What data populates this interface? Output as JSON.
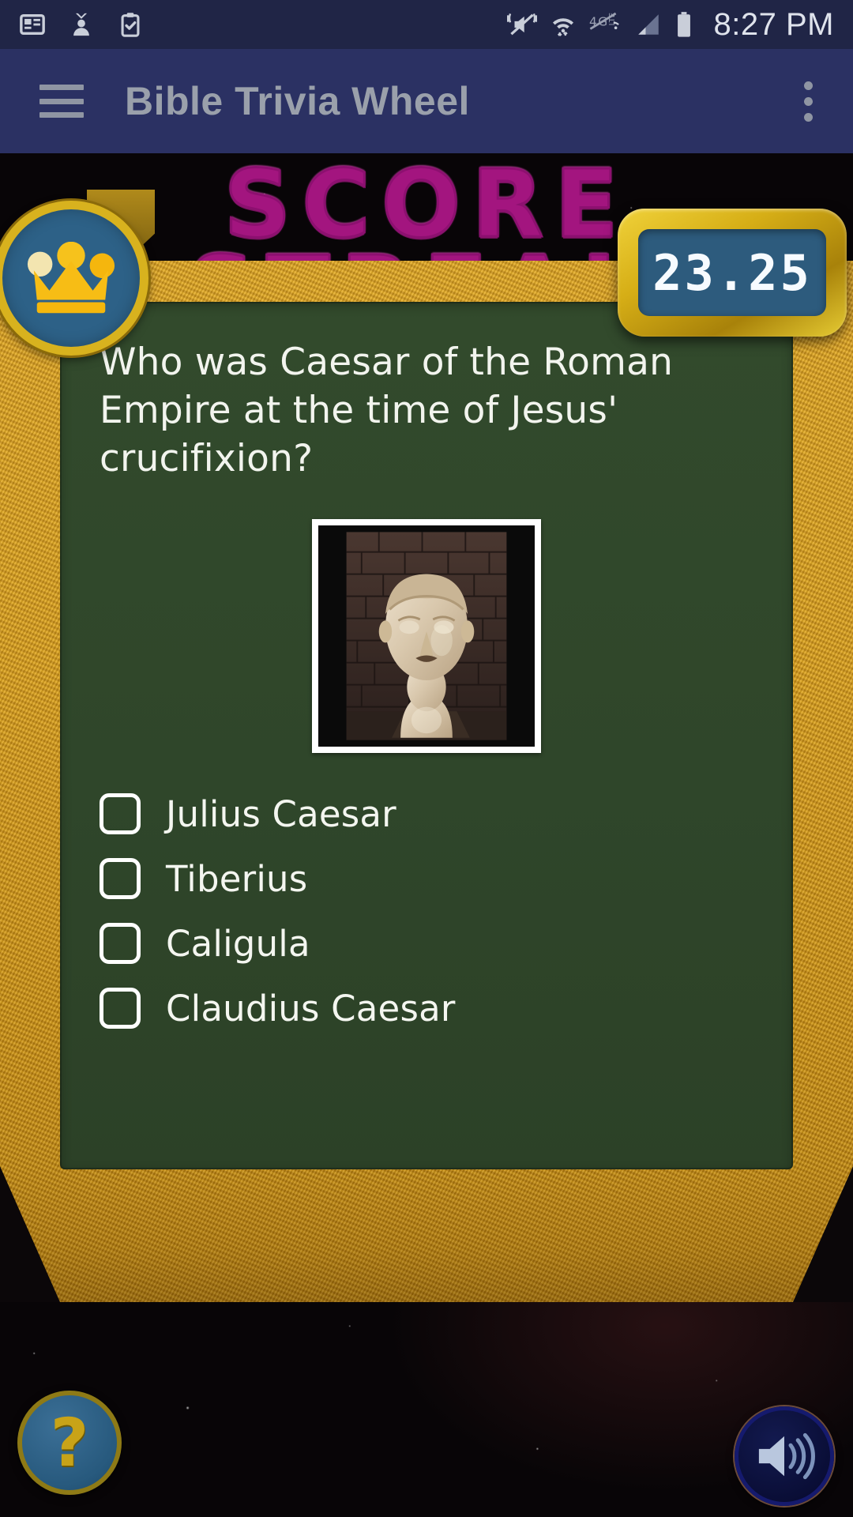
{
  "status_bar": {
    "time": "8:27 PM",
    "left_icons": [
      "news-card-icon",
      "contact-sync-icon",
      "clipboard-check-icon"
    ],
    "right_icons": [
      "vibrate-mute-icon",
      "wifi-icon",
      "lte-off-icon",
      "cell-signal-icon",
      "battery-icon"
    ]
  },
  "app_bar": {
    "title": "Bible Trivia Wheel",
    "menu_icon": "hamburger-menu-icon",
    "overflow_icon": "overflow-menu-icon"
  },
  "background": {
    "score_word_line1": "SCORE",
    "score_word_line2": "STREAK",
    "score_color": "#a3157f"
  },
  "crown_badge": {
    "icon": "crown-icon",
    "circle_color": "#2d6187",
    "rim_color": "#d8b21e"
  },
  "timer": {
    "value": "23.25",
    "screen_color": "#2d5b7d",
    "frame_color": "#d6ae16"
  },
  "question": {
    "text": "Who was Caesar of the Roman Empire at the time of Jesus' crucifixion?",
    "image_alt": "roman-bust-statue",
    "board_color": "#2f462a",
    "frame_color": "#d99f1c"
  },
  "options": [
    {
      "label": "Julius Caesar",
      "checked": false
    },
    {
      "label": "Tiberius",
      "checked": false
    },
    {
      "label": "Caligula",
      "checked": false
    },
    {
      "label": "Claudius Caesar",
      "checked": false
    }
  ],
  "bottom_bar": {
    "help_label": "?",
    "help_icon": "question-mark-icon",
    "sound_icon": "speaker-on-icon"
  }
}
